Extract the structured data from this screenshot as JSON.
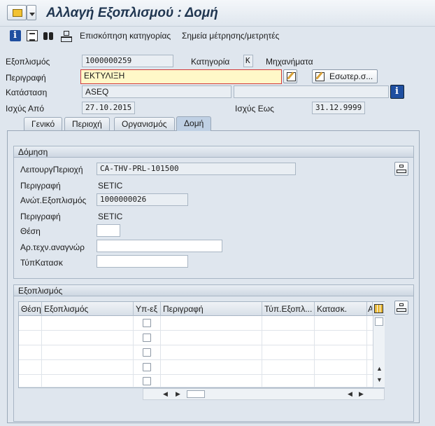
{
  "window": {
    "title": "Αλλαγή Εξοπλισμού : Δομή"
  },
  "toolbar": {
    "category_overview": "Επισκόπηση κατηγορίας",
    "measuring_points": "Σημεία μέτρησης/μετρητές"
  },
  "header": {
    "equipment_label": "Εξοπλισμός",
    "equipment_value": "1000000259",
    "category_label": "Κατηγορία",
    "category_value": "K",
    "category_text": "Μηχανήματα",
    "description_label": "Περιγραφή",
    "description_value": "ΕΚΤΥΛΙΞΗ",
    "internal_button": "Εσωτερ.σ...",
    "status_label": "Κατάσταση",
    "status_value": "ASEQ",
    "valid_from_label": "Ισχύς Από",
    "valid_from_value": "27.10.2015",
    "valid_to_label": "Ισχύς Εως",
    "valid_to_value": "31.12.9999"
  },
  "tabs": [
    {
      "label": "Γενικό",
      "active": false
    },
    {
      "label": "Περιοχή",
      "active": false
    },
    {
      "label": "Οργανισμός",
      "active": false
    },
    {
      "label": "Δομή",
      "active": true
    }
  ],
  "structure": {
    "title": "Δόμηση",
    "func_location_label": "ΛειτουργΠεριοχή",
    "func_location_value": "CA-THV-PRL-101500",
    "func_desc_label": "Περιγραφή",
    "func_desc_value": "SETIC",
    "superior_label": "Ανώτ.Εξοπλισμός",
    "superior_value": "1000000026",
    "superior_desc_label": "Περιγραφή",
    "superior_desc_value": "SETIC",
    "position_label": "Θέση",
    "position_value": "",
    "tech_id_label": "Αρ.τεχν.αναγνώρ",
    "tech_id_value": "",
    "manuf_type_label": "ΤύπΚατασκ",
    "manuf_type_value": ""
  },
  "equipment_table": {
    "title": "Εξοπλισμός",
    "columns": [
      "Θέση",
      "Εξοπλισμός",
      "Υπ-εξ",
      "Περιγραφή",
      "Τύπ.Εξοπλ...",
      "Κατασκ.",
      "Α"
    ],
    "rows": [
      {
        "position": "",
        "equipment": "",
        "sub": false,
        "description": "",
        "type": "",
        "manuf": ""
      },
      {
        "position": "",
        "equipment": "",
        "sub": false,
        "description": "",
        "type": "",
        "manuf": ""
      },
      {
        "position": "",
        "equipment": "",
        "sub": false,
        "description": "",
        "type": "",
        "manuf": ""
      },
      {
        "position": "",
        "equipment": "",
        "sub": false,
        "description": "",
        "type": "",
        "manuf": ""
      },
      {
        "position": "",
        "equipment": "",
        "sub": false,
        "description": "",
        "type": "",
        "manuf": ""
      }
    ]
  },
  "colors": {
    "background": "#dfe6ee",
    "title": "#1f3550",
    "active_field": "#fff8c8"
  }
}
